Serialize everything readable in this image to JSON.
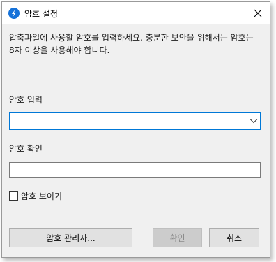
{
  "window": {
    "title": "암호 설정"
  },
  "description": "압축파일에 사용할 암호를 입력하세요. 충분한 보안을 위해서는 암호는 8자 이상을 사용해야 합니다.",
  "password_input": {
    "label": "암호 입력",
    "value": ""
  },
  "password_confirm": {
    "label": "암호 확인",
    "value": ""
  },
  "show_password": {
    "label": "암호 보이기",
    "checked": false
  },
  "buttons": {
    "manager": "암호 관리자...",
    "ok": "확인",
    "cancel": "취소"
  },
  "colors": {
    "accent": "#0078d7",
    "app_icon": "#1672d9",
    "dialog_bg": "#f0f0f0"
  },
  "icons": {
    "app": "bandizip-app-icon",
    "close": "close-icon",
    "dropdown": "chevron-down-icon"
  }
}
